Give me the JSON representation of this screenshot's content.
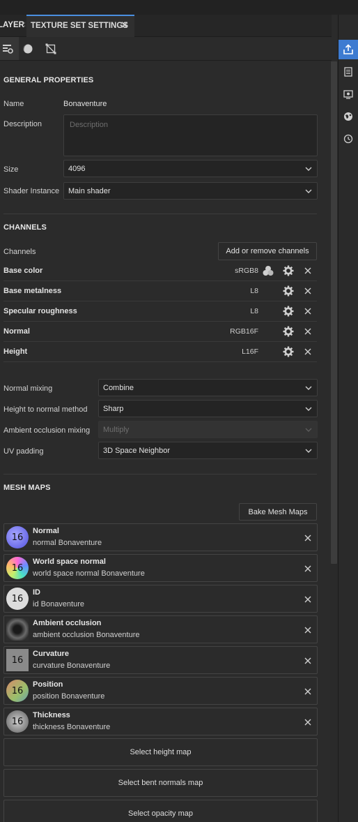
{
  "tabs": {
    "layers": "LAYERS",
    "texture_set_settings": "TEXTURE SET SETTINGS",
    "close_glyph": "✕"
  },
  "general": {
    "title": "GENERAL PROPERTIES",
    "name_label": "Name",
    "name_value": "Bonaventure",
    "description_label": "Description",
    "description_placeholder": "Description",
    "size_label": "Size",
    "size_value": "4096",
    "shader_label": "Shader Instance",
    "shader_value": "Main shader"
  },
  "channels": {
    "title": "CHANNELS",
    "label": "Channels",
    "add_remove_button": "Add or remove channels",
    "items": [
      {
        "name": "Base color",
        "format": "sRGB8"
      },
      {
        "name": "Base metalness",
        "format": "L8"
      },
      {
        "name": "Specular roughness",
        "format": "L8"
      },
      {
        "name": "Normal",
        "format": "RGB16F"
      },
      {
        "name": "Height",
        "format": "L16F"
      }
    ]
  },
  "mixing": {
    "normal_mixing_label": "Normal mixing",
    "normal_mixing_value": "Combine",
    "height_to_normal_label": "Height to normal method",
    "height_to_normal_value": "Sharp",
    "ao_mixing_label": "Ambient occlusion mixing",
    "ao_mixing_value": "Multiply",
    "uv_padding_label": "UV padding",
    "uv_padding_value": "3D Space Neighbor"
  },
  "mesh_maps": {
    "title": "MESH MAPS",
    "bake_button": "Bake Mesh Maps",
    "items": [
      {
        "title": "Normal",
        "subtitle": "normal Bonaventure",
        "thumb_text": "16",
        "color": "#7b7bf0"
      },
      {
        "title": "World space normal",
        "subtitle": "world space normal Bonaventure",
        "thumb_text": "16",
        "color": "#c080c0"
      },
      {
        "title": "ID",
        "subtitle": "id Bonaventure",
        "thumb_text": "16",
        "color": "#dcdcdc"
      },
      {
        "title": "Ambient occlusion",
        "subtitle": "ambient occlusion Bonaventure",
        "thumb_text": "",
        "color": "#555555"
      },
      {
        "title": "Curvature",
        "subtitle": "curvature Bonaventure",
        "thumb_text": "16",
        "color": "#8a8a8a"
      },
      {
        "title": "Position",
        "subtitle": "position Bonaventure",
        "thumb_text": "16",
        "color": "#a0906a"
      },
      {
        "title": "Thickness",
        "subtitle": "thickness Bonaventure",
        "thumb_text": "16",
        "color": "#a8a8a8"
      }
    ],
    "select_height": "Select height map",
    "select_bent_normals": "Select bent normals map",
    "select_opacity": "Select opacity map"
  },
  "colors": {
    "accent": "#3d7bd1",
    "panel_bg": "#2b2b2b"
  }
}
